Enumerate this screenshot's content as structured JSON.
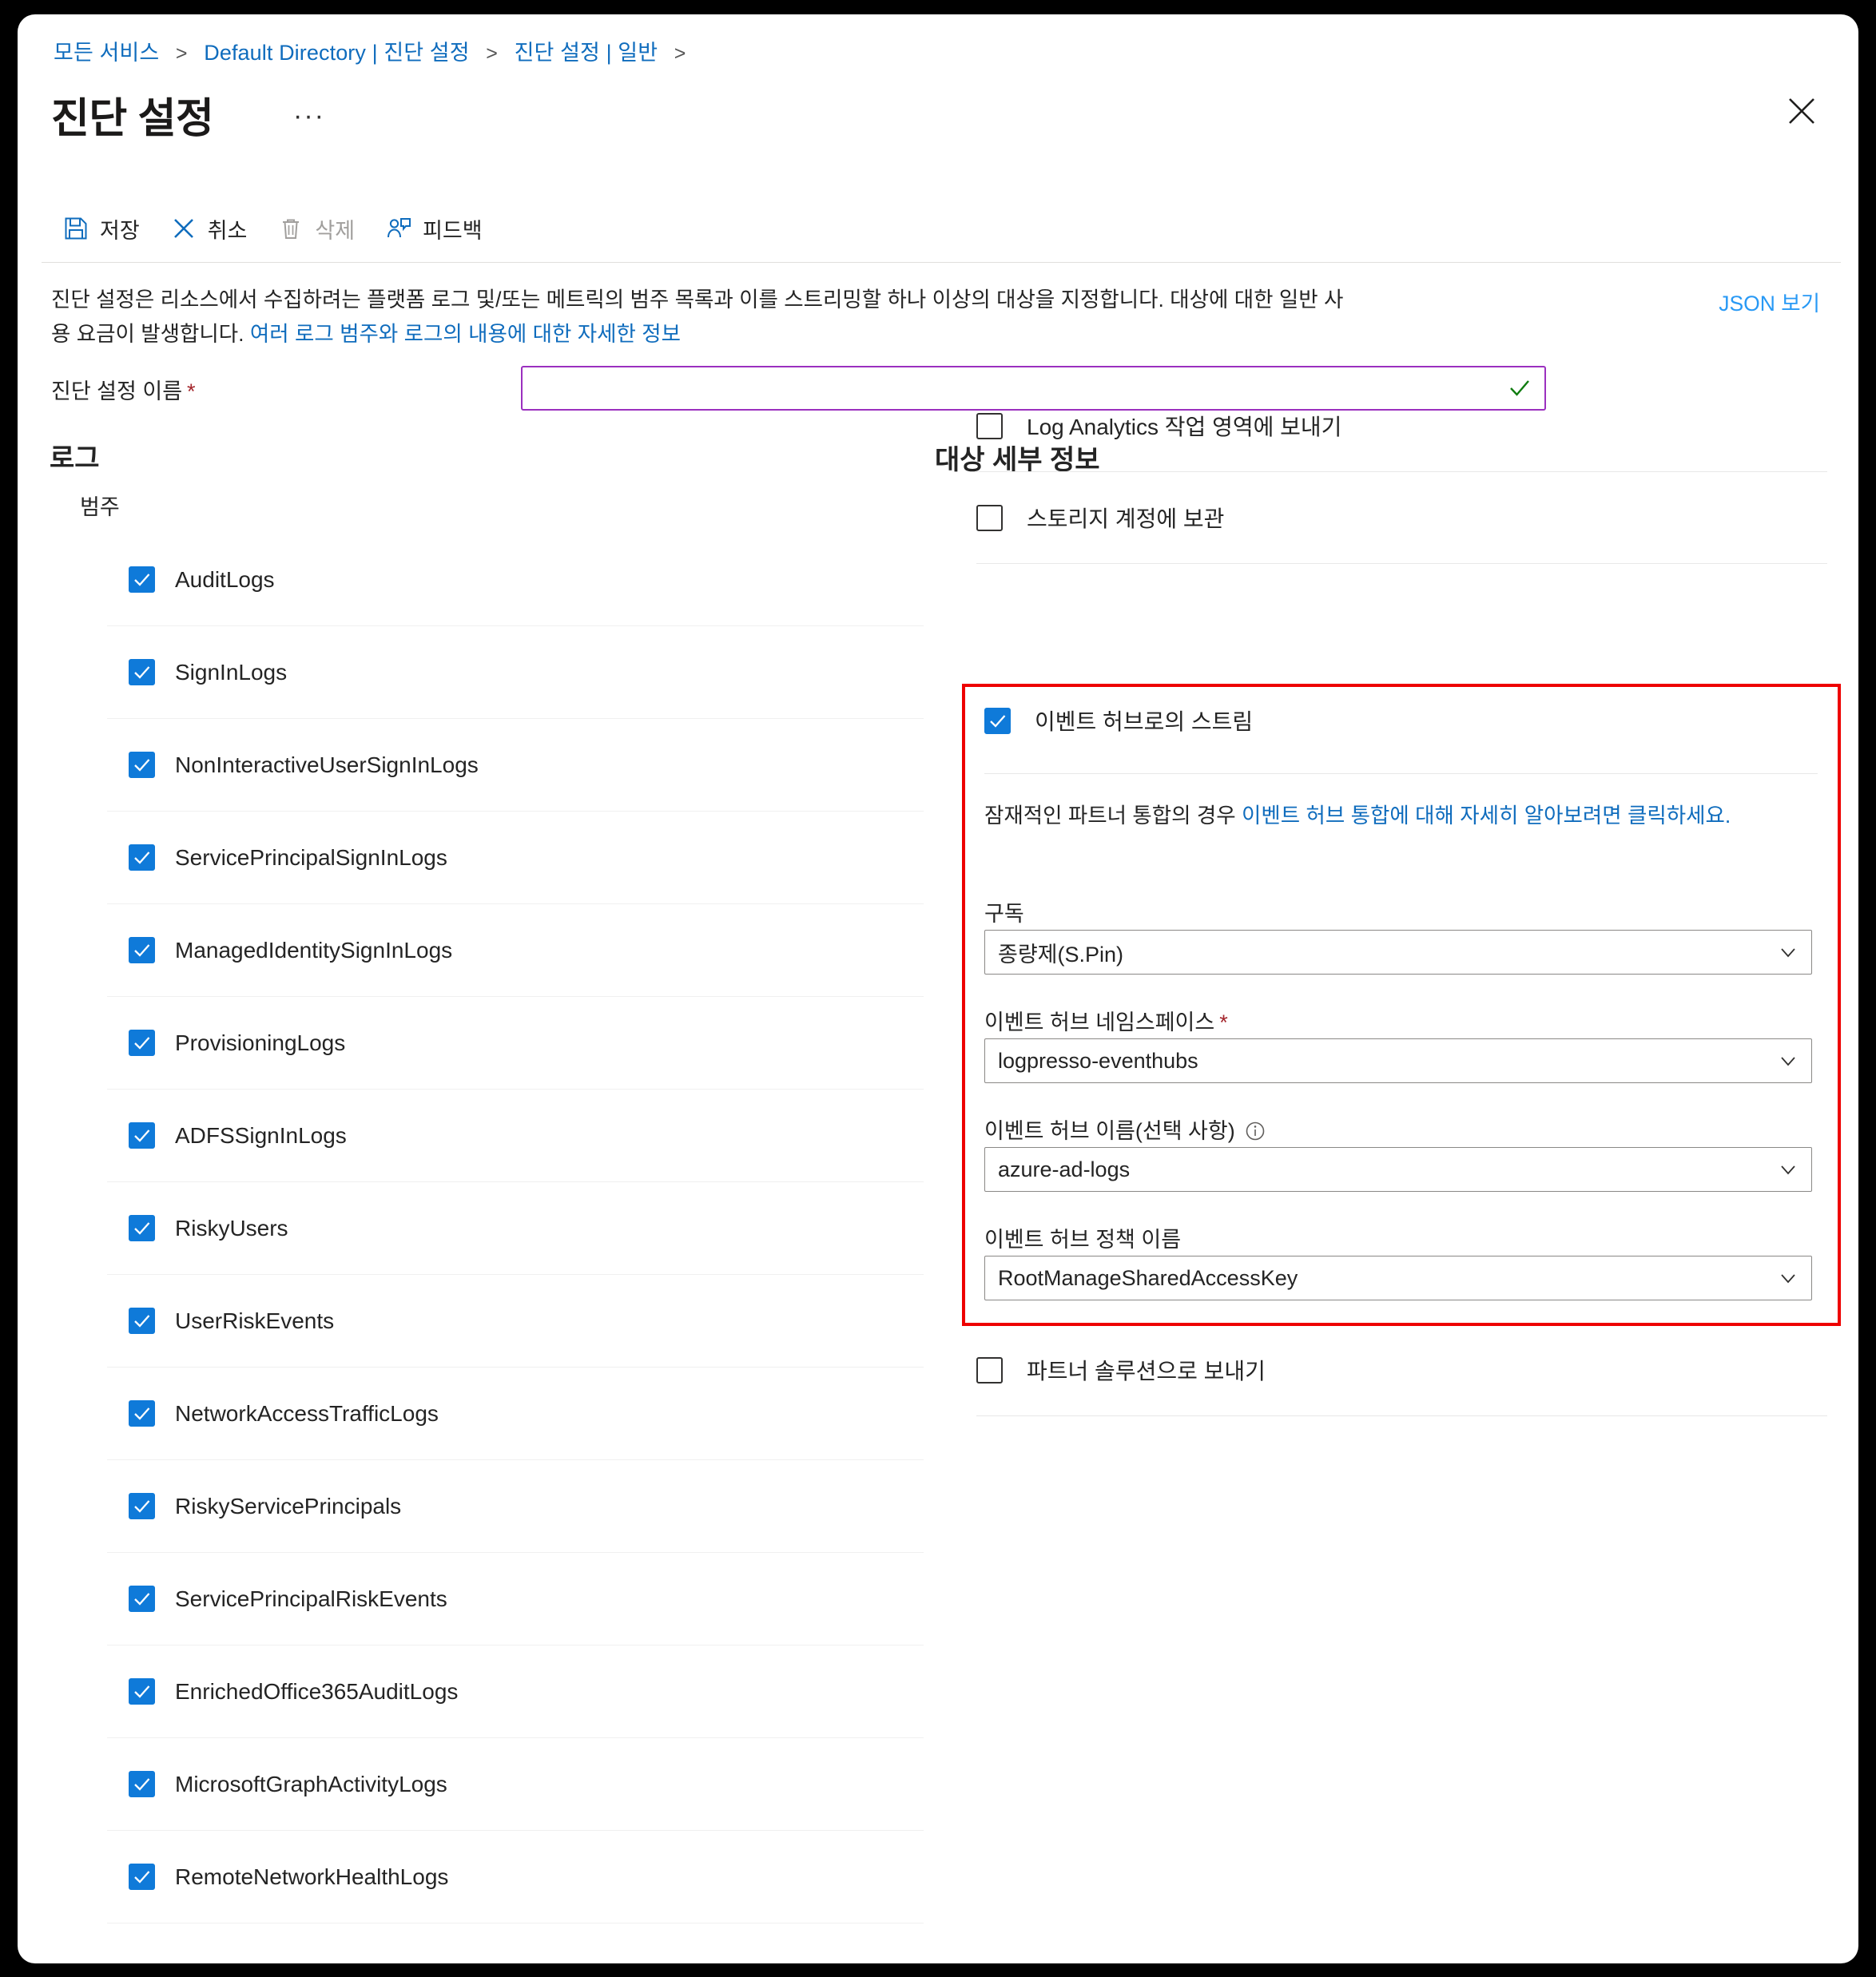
{
  "breadcrumb": {
    "items": [
      "모든 서비스",
      "Default Directory | 진단 설정",
      "진단 설정 | 일반"
    ],
    "separator": ">"
  },
  "header": {
    "title": "진단 설정",
    "ellipsis": "···",
    "close_icon": "close-icon"
  },
  "toolbar": {
    "save_label": "저장",
    "cancel_label": "취소",
    "delete_label": "삭제",
    "feedback_label": "피드백"
  },
  "description": {
    "text_part1": "진단 설정은 리소스에서 수집하려는 플랫폼 로그 및/또는 메트릭의 범주 목록과 이를 스트리밍할 하나 이상의 대상을 지정합니다. 대상에 대한 일반 사용 요금이 발생합니다. ",
    "link_text": "여러 로그 범주와 로그의 내용에 대한 자세한 정보",
    "json_view_label": "JSON 보기"
  },
  "name_field": {
    "label": "진단 설정 이름",
    "required_marker": "*",
    "value": "",
    "placeholder": "",
    "valid_icon": "checkmark-icon",
    "border_color": "#9b30bf",
    "valid_color": "#107c10"
  },
  "logs": {
    "heading": "로그",
    "categories_label": "범주",
    "items": [
      {
        "label": "AuditLogs",
        "checked": true
      },
      {
        "label": "SignInLogs",
        "checked": true
      },
      {
        "label": "NonInteractiveUserSignInLogs",
        "checked": true
      },
      {
        "label": "ServicePrincipalSignInLogs",
        "checked": true
      },
      {
        "label": "ManagedIdentitySignInLogs",
        "checked": true
      },
      {
        "label": "ProvisioningLogs",
        "checked": true
      },
      {
        "label": "ADFSSignInLogs",
        "checked": true
      },
      {
        "label": "RiskyUsers",
        "checked": true
      },
      {
        "label": "UserRiskEvents",
        "checked": true
      },
      {
        "label": "NetworkAccessTrafficLogs",
        "checked": true
      },
      {
        "label": "RiskyServicePrincipals",
        "checked": true
      },
      {
        "label": "ServicePrincipalRiskEvents",
        "checked": true
      },
      {
        "label": "EnrichedOffice365AuditLogs",
        "checked": true
      },
      {
        "label": "MicrosoftGraphActivityLogs",
        "checked": true
      },
      {
        "label": "RemoteNetworkHealthLogs",
        "checked": true
      }
    ]
  },
  "destination": {
    "heading": "대상 세부 정보",
    "log_analytics": {
      "label": "Log Analytics 작업 영역에 보내기",
      "checked": false
    },
    "storage_account": {
      "label": "스토리지 계정에 보관",
      "checked": false
    },
    "event_hub": {
      "label": "이벤트 허브로의 스트림",
      "checked": true,
      "highlight_color": "#ee0000",
      "note_prefix": "잠재적인 파트너 통합의 경우 ",
      "note_link": "이벤트 허브 통합에 대해 자세히 알아보려면 클릭하세요.",
      "subscription": {
        "label": "구독",
        "value": "종량제(S.Pin)"
      },
      "namespace": {
        "label": "이벤트 허브 네임스페이스",
        "required_marker": "*",
        "value": "logpresso-eventhubs"
      },
      "hub_name": {
        "label": "이벤트 허브 이름(선택 사항)",
        "info_icon": "info-icon",
        "value": "azure-ad-logs"
      },
      "policy_name": {
        "label": "이벤트 허브 정책 이름",
        "value": "RootManageSharedAccessKey"
      }
    },
    "partner_solution": {
      "label": "파트너 솔루션으로 보내기",
      "checked": false
    }
  },
  "colors": {
    "link_blue": "#0f6cbd",
    "checkbox_blue": "#0f7ad9",
    "accent_purple": "#9b30bf",
    "highlight_red": "#ee0000"
  }
}
